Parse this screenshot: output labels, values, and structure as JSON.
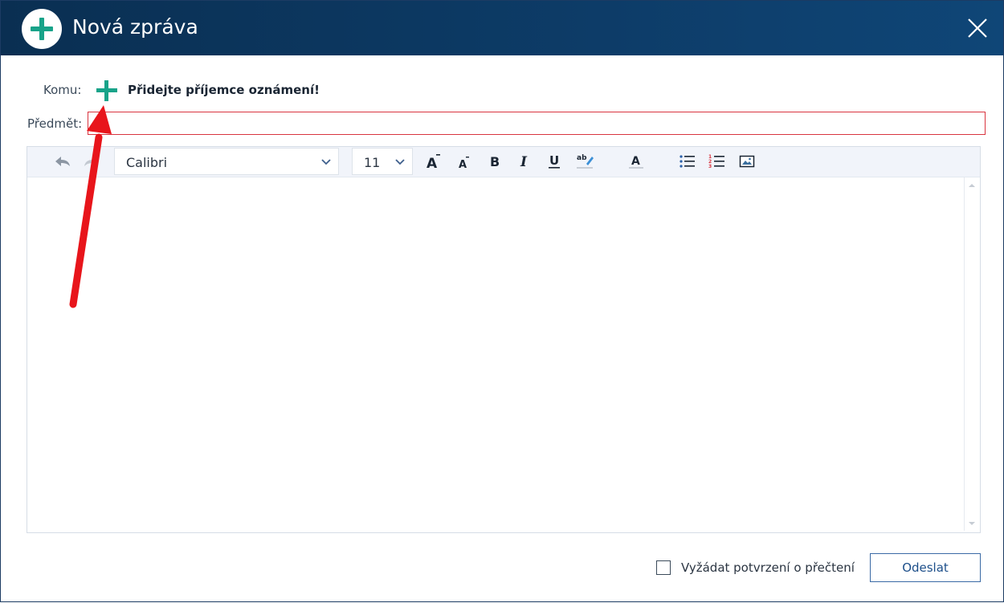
{
  "dialog": {
    "title": "Nová zpráva",
    "accent_color": "#18a389",
    "header_color": "#0d3c68"
  },
  "form": {
    "to_label": "Komu:",
    "recipient_hint": "Přidejte příjemce oznámení!",
    "subject_label": "Předmět:",
    "subject_value": ""
  },
  "toolbar": {
    "font_family": "Calibri",
    "font_size": "11",
    "buttons": [
      "undo-icon",
      "redo-icon",
      "increase-font-icon",
      "decrease-font-icon",
      "bold-icon",
      "italic-icon",
      "underline-icon",
      "highlight-icon",
      "font-color-icon",
      "bulleted-list-icon",
      "numbered-list-icon",
      "insert-image-icon"
    ]
  },
  "footer": {
    "read_receipt_label": "Vyžádat potvrzení o přečtení",
    "read_receipt_checked": false,
    "send_label": "Odeslat"
  },
  "annotation": {
    "arrow_color": "#e8151b"
  }
}
